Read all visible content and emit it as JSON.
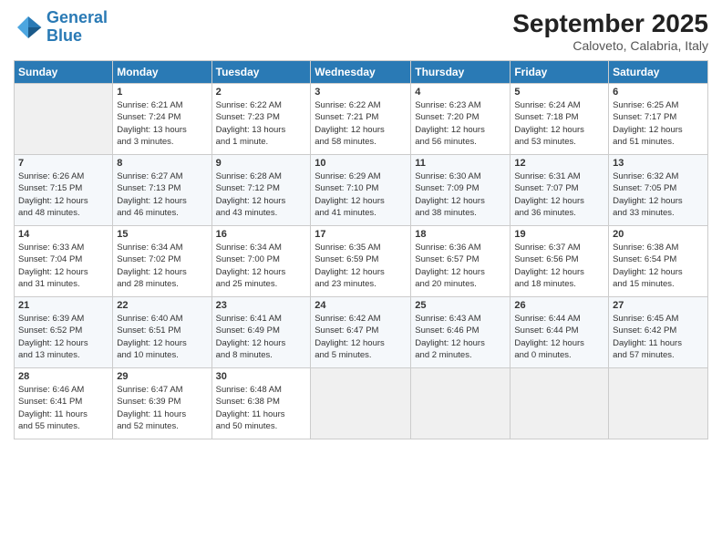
{
  "header": {
    "logo_line1": "General",
    "logo_line2": "Blue",
    "month_title": "September 2025",
    "subtitle": "Caloveto, Calabria, Italy"
  },
  "days_of_week": [
    "Sunday",
    "Monday",
    "Tuesday",
    "Wednesday",
    "Thursday",
    "Friday",
    "Saturday"
  ],
  "weeks": [
    [
      {
        "num": "",
        "info": ""
      },
      {
        "num": "1",
        "info": "Sunrise: 6:21 AM\nSunset: 7:24 PM\nDaylight: 13 hours\nand 3 minutes."
      },
      {
        "num": "2",
        "info": "Sunrise: 6:22 AM\nSunset: 7:23 PM\nDaylight: 13 hours\nand 1 minute."
      },
      {
        "num": "3",
        "info": "Sunrise: 6:22 AM\nSunset: 7:21 PM\nDaylight: 12 hours\nand 58 minutes."
      },
      {
        "num": "4",
        "info": "Sunrise: 6:23 AM\nSunset: 7:20 PM\nDaylight: 12 hours\nand 56 minutes."
      },
      {
        "num": "5",
        "info": "Sunrise: 6:24 AM\nSunset: 7:18 PM\nDaylight: 12 hours\nand 53 minutes."
      },
      {
        "num": "6",
        "info": "Sunrise: 6:25 AM\nSunset: 7:17 PM\nDaylight: 12 hours\nand 51 minutes."
      }
    ],
    [
      {
        "num": "7",
        "info": "Sunrise: 6:26 AM\nSunset: 7:15 PM\nDaylight: 12 hours\nand 48 minutes."
      },
      {
        "num": "8",
        "info": "Sunrise: 6:27 AM\nSunset: 7:13 PM\nDaylight: 12 hours\nand 46 minutes."
      },
      {
        "num": "9",
        "info": "Sunrise: 6:28 AM\nSunset: 7:12 PM\nDaylight: 12 hours\nand 43 minutes."
      },
      {
        "num": "10",
        "info": "Sunrise: 6:29 AM\nSunset: 7:10 PM\nDaylight: 12 hours\nand 41 minutes."
      },
      {
        "num": "11",
        "info": "Sunrise: 6:30 AM\nSunset: 7:09 PM\nDaylight: 12 hours\nand 38 minutes."
      },
      {
        "num": "12",
        "info": "Sunrise: 6:31 AM\nSunset: 7:07 PM\nDaylight: 12 hours\nand 36 minutes."
      },
      {
        "num": "13",
        "info": "Sunrise: 6:32 AM\nSunset: 7:05 PM\nDaylight: 12 hours\nand 33 minutes."
      }
    ],
    [
      {
        "num": "14",
        "info": "Sunrise: 6:33 AM\nSunset: 7:04 PM\nDaylight: 12 hours\nand 31 minutes."
      },
      {
        "num": "15",
        "info": "Sunrise: 6:34 AM\nSunset: 7:02 PM\nDaylight: 12 hours\nand 28 minutes."
      },
      {
        "num": "16",
        "info": "Sunrise: 6:34 AM\nSunset: 7:00 PM\nDaylight: 12 hours\nand 25 minutes."
      },
      {
        "num": "17",
        "info": "Sunrise: 6:35 AM\nSunset: 6:59 PM\nDaylight: 12 hours\nand 23 minutes."
      },
      {
        "num": "18",
        "info": "Sunrise: 6:36 AM\nSunset: 6:57 PM\nDaylight: 12 hours\nand 20 minutes."
      },
      {
        "num": "19",
        "info": "Sunrise: 6:37 AM\nSunset: 6:56 PM\nDaylight: 12 hours\nand 18 minutes."
      },
      {
        "num": "20",
        "info": "Sunrise: 6:38 AM\nSunset: 6:54 PM\nDaylight: 12 hours\nand 15 minutes."
      }
    ],
    [
      {
        "num": "21",
        "info": "Sunrise: 6:39 AM\nSunset: 6:52 PM\nDaylight: 12 hours\nand 13 minutes."
      },
      {
        "num": "22",
        "info": "Sunrise: 6:40 AM\nSunset: 6:51 PM\nDaylight: 12 hours\nand 10 minutes."
      },
      {
        "num": "23",
        "info": "Sunrise: 6:41 AM\nSunset: 6:49 PM\nDaylight: 12 hours\nand 8 minutes."
      },
      {
        "num": "24",
        "info": "Sunrise: 6:42 AM\nSunset: 6:47 PM\nDaylight: 12 hours\nand 5 minutes."
      },
      {
        "num": "25",
        "info": "Sunrise: 6:43 AM\nSunset: 6:46 PM\nDaylight: 12 hours\nand 2 minutes."
      },
      {
        "num": "26",
        "info": "Sunrise: 6:44 AM\nSunset: 6:44 PM\nDaylight: 12 hours\nand 0 minutes."
      },
      {
        "num": "27",
        "info": "Sunrise: 6:45 AM\nSunset: 6:42 PM\nDaylight: 11 hours\nand 57 minutes."
      }
    ],
    [
      {
        "num": "28",
        "info": "Sunrise: 6:46 AM\nSunset: 6:41 PM\nDaylight: 11 hours\nand 55 minutes."
      },
      {
        "num": "29",
        "info": "Sunrise: 6:47 AM\nSunset: 6:39 PM\nDaylight: 11 hours\nand 52 minutes."
      },
      {
        "num": "30",
        "info": "Sunrise: 6:48 AM\nSunset: 6:38 PM\nDaylight: 11 hours\nand 50 minutes."
      },
      {
        "num": "",
        "info": ""
      },
      {
        "num": "",
        "info": ""
      },
      {
        "num": "",
        "info": ""
      },
      {
        "num": "",
        "info": ""
      }
    ]
  ]
}
